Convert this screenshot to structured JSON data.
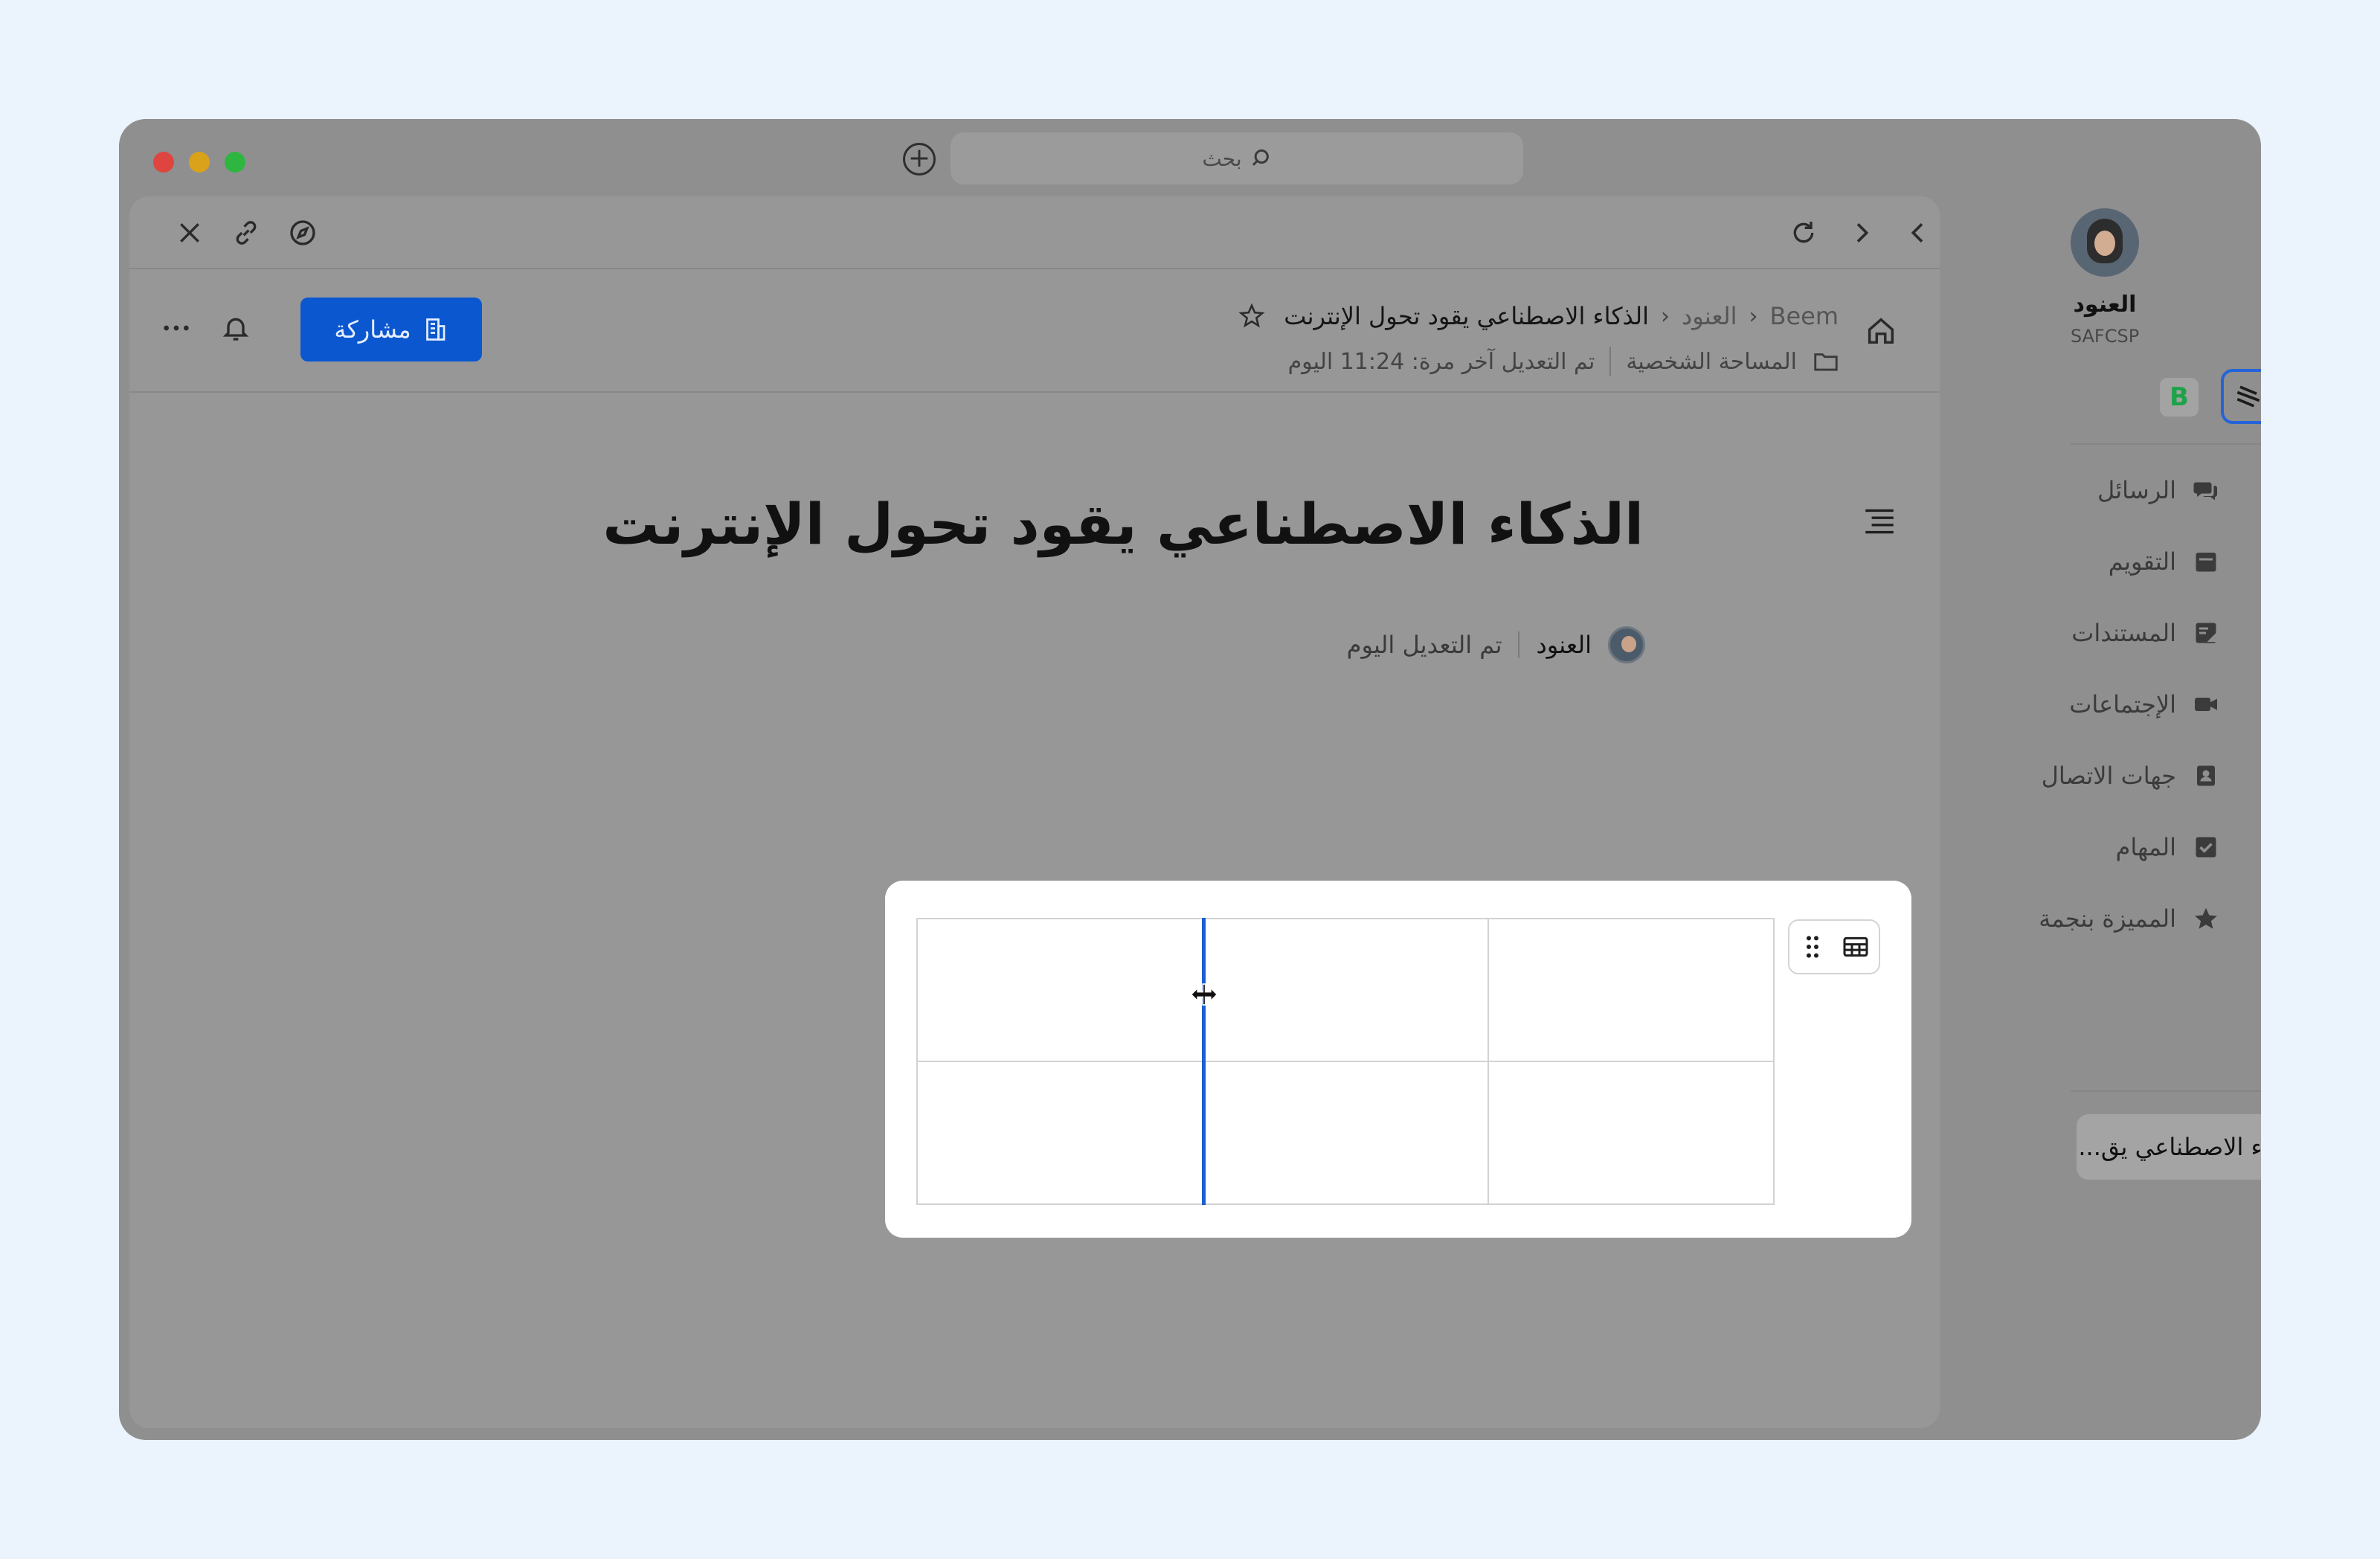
{
  "browser": {
    "search_placeholder": "بحث"
  },
  "header": {
    "breadcrumb": [
      "Beem",
      "العنود",
      "الذكاء الاصطناعي يقود تحول الإنترنت"
    ],
    "location": "المساحة الشخصية",
    "last_modified": "تم التعديل آخر مرة: 11:24 اليوم",
    "share_label": "مشاركة"
  },
  "document": {
    "title": "الذكاء الاصطناعي يقود تحول الإنترنت",
    "author": "العنود",
    "edited": "تم التعديل اليوم",
    "table": {
      "rows": [
        [
          "",
          "",
          ""
        ],
        [
          "",
          "",
          ""
        ]
      ]
    }
  },
  "sidebar": {
    "user_name": "العنود",
    "org": "SAFCSP",
    "workspace_badge": "B",
    "items": [
      {
        "label": "الرسائل",
        "icon": "chat-icon"
      },
      {
        "label": "التقويم",
        "icon": "calendar-icon"
      },
      {
        "label": "المستندات",
        "icon": "documents-icon"
      },
      {
        "label": "الإجتماعات",
        "icon": "video-icon"
      },
      {
        "label": "جهات الاتصال",
        "icon": "contacts-icon"
      },
      {
        "label": "المهام",
        "icon": "tasks-icon"
      },
      {
        "label": "المميزة بنجمة",
        "icon": "star-icon"
      }
    ],
    "open_doc": "الذكاء الاصطناعي يق..."
  },
  "colors": {
    "accent": "#0b57d0",
    "background": "#ebf3fd",
    "overlay": "#979797",
    "resize_line": "#1a5fd4"
  }
}
